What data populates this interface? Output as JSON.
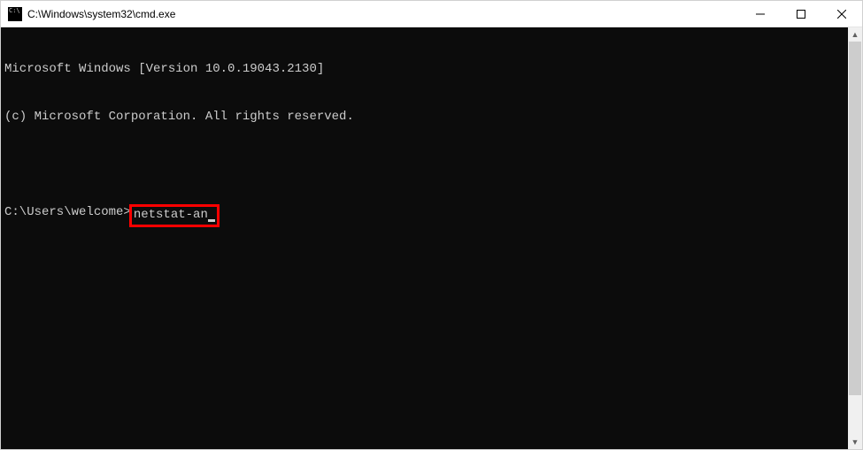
{
  "window": {
    "title": "C:\\Windows\\system32\\cmd.exe"
  },
  "terminal": {
    "banner_line1": "Microsoft Windows [Version 10.0.19043.2130]",
    "banner_line2": "(c) Microsoft Corporation. All rights reserved.",
    "prompt": "C:\\Users\\welcome>",
    "command": "netstat-an"
  }
}
